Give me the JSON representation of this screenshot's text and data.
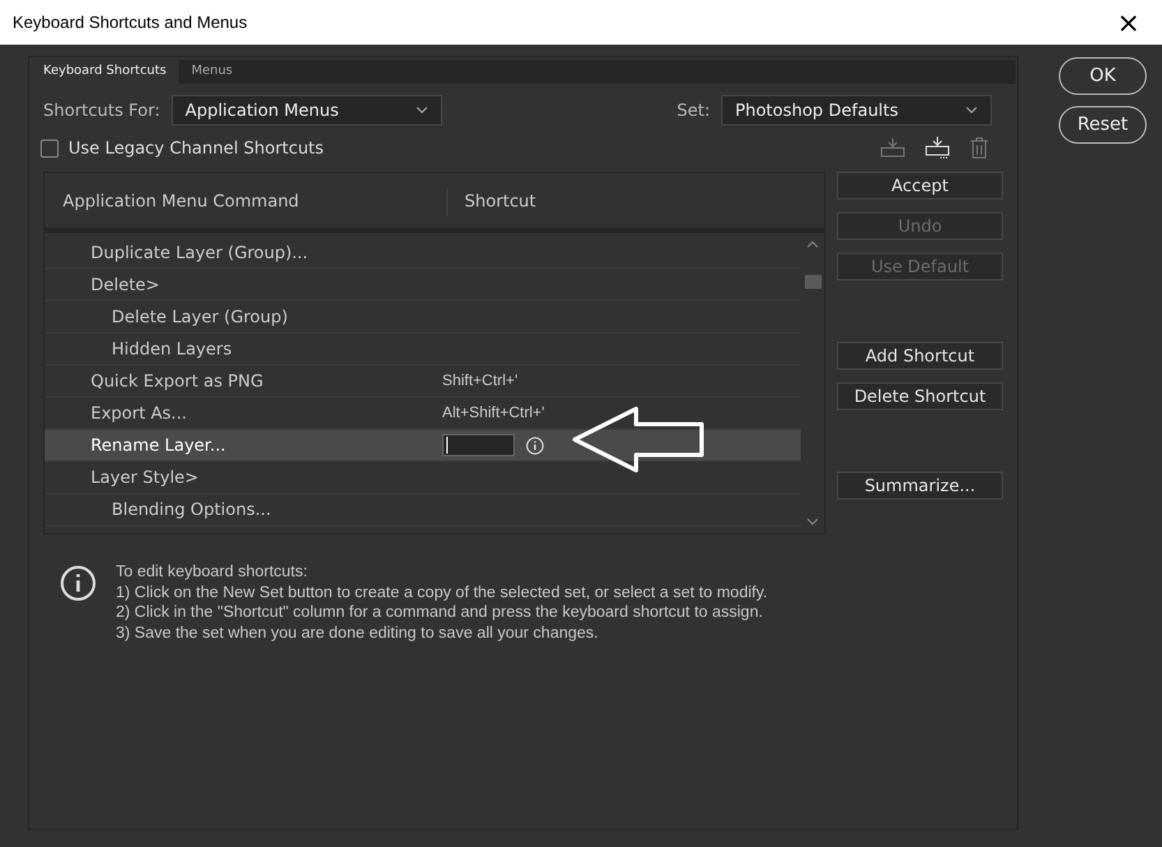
{
  "window": {
    "title": "Keyboard Shortcuts and Menus",
    "close": "×"
  },
  "tabs": [
    {
      "label": "Keyboard Shortcuts",
      "selected": true
    },
    {
      "label": "Menus",
      "selected": false
    }
  ],
  "shortcuts_for": {
    "label": "Shortcuts For:",
    "value": "Application Menus"
  },
  "set": {
    "label": "Set:",
    "value": "Photoshop Defaults"
  },
  "legacy_checkbox": {
    "label": "Use Legacy Channel Shortcuts",
    "checked": false
  },
  "table": {
    "columns": [
      "Application Menu Command",
      "Shortcut"
    ],
    "rows": [
      {
        "command": "Duplicate Layer (Group)...",
        "indented": false,
        "selected": false
      },
      {
        "command": "Delete>",
        "indented": false,
        "selected": false
      },
      {
        "command": "Delete Layer (Group)",
        "indented": true,
        "selected": false
      },
      {
        "command": "Hidden Layers",
        "indented": true,
        "selected": false
      },
      {
        "command": "Quick Export as PNG",
        "shortcut": "Shift+Ctrl+'",
        "indented": false,
        "selected": false
      },
      {
        "command": "Export As...",
        "shortcut": "Alt+Shift+Ctrl+'",
        "indented": false,
        "selected": false
      },
      {
        "command": "Rename Layer...",
        "editing": true,
        "indented": false,
        "selected": true
      },
      {
        "command": "Layer Style>",
        "indented": false,
        "selected": false
      },
      {
        "command": "Blending Options...",
        "indented": true,
        "selected": false
      }
    ]
  },
  "side_buttons": [
    {
      "label": "Accept",
      "disabled": false
    },
    {
      "label": "Undo",
      "disabled": true
    },
    {
      "label": "Use Default",
      "disabled": true
    },
    {
      "label": "Add Shortcut",
      "disabled": false
    },
    {
      "label": "Delete Shortcut",
      "disabled": false
    },
    {
      "label": "Summarize...",
      "disabled": false
    }
  ],
  "info": {
    "lines": [
      "To edit keyboard shortcuts:",
      "1) Click on the New Set button to create a copy of the selected set, or select a set to modify.",
      "2) Click in the \"Shortcut\" column for a command and press the keyboard shortcut to assign.",
      "3) Save the set when you are done editing to save all your changes."
    ]
  },
  "dialog_buttons": [
    "OK",
    "Reset"
  ]
}
